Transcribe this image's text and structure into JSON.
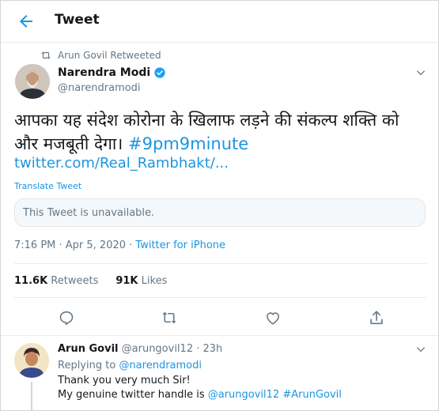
{
  "header": {
    "title": "Tweet",
    "back_icon": "back-arrow-icon"
  },
  "retweet_context": {
    "text": "Arun Govil Retweeted",
    "icon": "retweet-icon"
  },
  "tweet": {
    "author_name": "Narendra Modi",
    "author_handle": "@narendramodi",
    "verified": true,
    "text_line1": "आपका यह संदेश कोरोना के खिलाफ लड़ने की संकल्प शक्ति को",
    "text_line2": "और मजबूती देगा।",
    "hashtag": "#9pm9minute",
    "link": "twitter.com/Real_Rambhakt/...",
    "translate": "Translate Tweet",
    "quoted_unavailable": "This Tweet is unavailable.",
    "time": "7:16 PM · Apr 5, 2020 · ",
    "source": "Twitter for iPhone",
    "retweets_count": "11.6K",
    "retweets_label": "Retweets",
    "likes_count": "91K",
    "likes_label": "Likes"
  },
  "actions": [
    "reply-icon",
    "retweet-icon",
    "like-icon",
    "share-icon"
  ],
  "reply": {
    "author_name": "Arun Govil",
    "author_handle": "@arungovil12",
    "time": "· 23h",
    "replying_prefix": "Replying to",
    "replying_to": "@narendramodi",
    "line1": "Thank you very much Sir!",
    "line2_prefix": "My genuine twitter handle is",
    "line2_handle": "@arungovil12",
    "line2_hashtag": "#ArunGovil"
  },
  "colors": {
    "accent": "#1b95e0",
    "muted": "#657786",
    "text": "#14171a"
  }
}
